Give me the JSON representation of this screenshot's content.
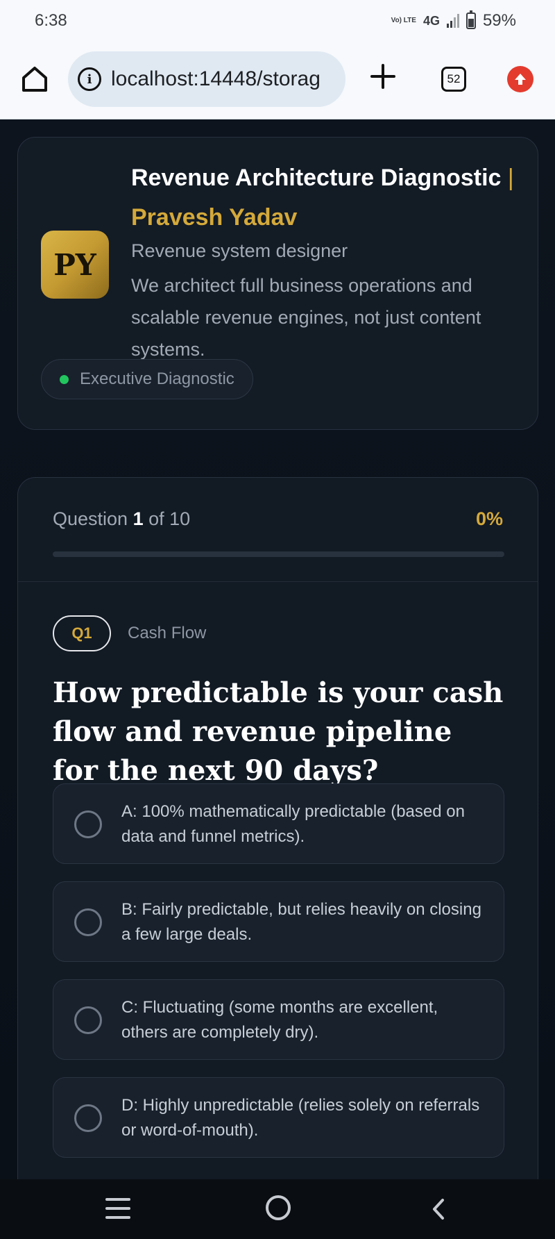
{
  "status_bar": {
    "time": "6:38",
    "volte": "Vo) LTE",
    "network": "4G",
    "battery": "59%",
    "battery_level": 0.59
  },
  "browser": {
    "url": "localhost:14448/storag",
    "tab_count": "52"
  },
  "profile": {
    "avatar_initials": "PY",
    "title": "Revenue Architecture Diagnostic",
    "separator": "|",
    "name": "Pravesh Yadav",
    "role": "Revenue system designer",
    "description": "We architect full business operations and scalable revenue engines, not just content systems.",
    "badge": "Executive Diagnostic"
  },
  "quiz": {
    "question_label": "Question",
    "current": "1",
    "of_label": "of 10",
    "progress_text": "0%",
    "progress_value": 0,
    "question_tag": "Q1",
    "category": "Cash Flow",
    "question": "How predictable is your cash flow and revenue pipeline for the next 90 days?",
    "options": [
      {
        "label": "A: 100% mathematically predictable (based on data and funnel metrics)."
      },
      {
        "label": "B: Fairly predictable, but relies heavily on closing a few large deals."
      },
      {
        "label": "C: Fluctuating (some months are excellent, others are completely dry)."
      },
      {
        "label": "D: Highly unpredictable (relies solely on referrals or word-of-mouth)."
      }
    ]
  },
  "colors": {
    "accent_gold": "#d4a93a",
    "background": "#0b1119",
    "badge_green": "#22c55e",
    "update_red": "#e33b2e"
  }
}
